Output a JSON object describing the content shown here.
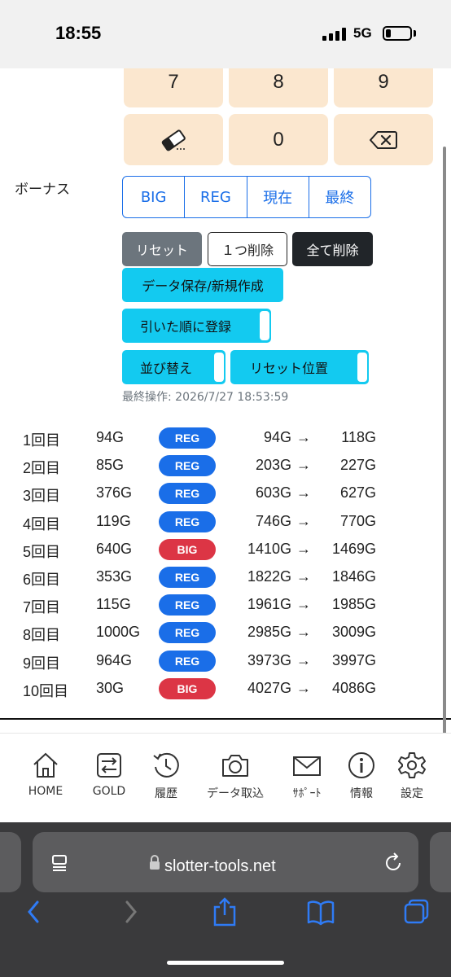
{
  "status": {
    "time": "18:55",
    "network": "5G",
    "battery_level": 0.2
  },
  "keypad": {
    "keys": [
      "7",
      "8",
      "9",
      "0"
    ],
    "eraser_icon": "eraser-icon",
    "backspace_icon": "backspace-icon"
  },
  "bonus": {
    "label": "ボーナス",
    "options": [
      "BIG",
      "REG",
      "現在",
      "最終"
    ]
  },
  "actions": {
    "reset": "リセット",
    "delete_one": "１つ削除",
    "delete_all": "全て削除",
    "save_new": "データ保存/新規作成",
    "register_order": "引いた順に登録",
    "sort": "並び替え",
    "reset_position": "リセット位置"
  },
  "last_operation": "最終操作: 2026/7/27 18:53:59",
  "colors": {
    "reg": "#1a6ee8",
    "big": "#dc3545",
    "cyan": "#13caf0",
    "keypad": "#fbe7cf"
  },
  "history": [
    {
      "n": "1回目",
      "g": "94G",
      "type": "REG",
      "from": "94G",
      "to": "118G"
    },
    {
      "n": "2回目",
      "g": "85G",
      "type": "REG",
      "from": "203G",
      "to": "227G"
    },
    {
      "n": "3回目",
      "g": "376G",
      "type": "REG",
      "from": "603G",
      "to": "627G"
    },
    {
      "n": "4回目",
      "g": "119G",
      "type": "REG",
      "from": "746G",
      "to": "770G"
    },
    {
      "n": "5回目",
      "g": "640G",
      "type": "BIG",
      "from": "1410G",
      "to": "1469G"
    },
    {
      "n": "6回目",
      "g": "353G",
      "type": "REG",
      "from": "1822G",
      "to": "1846G"
    },
    {
      "n": "7回目",
      "g": "115G",
      "type": "REG",
      "from": "1961G",
      "to": "1985G"
    },
    {
      "n": "8回目",
      "g": "1000G",
      "type": "REG",
      "from": "2985G",
      "to": "3009G"
    },
    {
      "n": "9回目",
      "g": "964G",
      "type": "REG",
      "from": "3973G",
      "to": "3997G"
    },
    {
      "n": "10回目",
      "g": "30G",
      "type": "BIG",
      "from": "4027G",
      "to": "4086G"
    }
  ],
  "arrow": "→",
  "tabs": [
    {
      "label": "HOME",
      "icon": "home-icon"
    },
    {
      "label": "GOLD",
      "icon": "exchange-icon"
    },
    {
      "label": "履歴",
      "icon": "history-icon"
    },
    {
      "label": "データ取込",
      "icon": "camera-icon"
    },
    {
      "label": "ｻﾎﾟｰﾄ",
      "icon": "mail-icon"
    },
    {
      "label": "情報",
      "icon": "info-icon"
    },
    {
      "label": "設定",
      "icon": "gear-icon"
    }
  ],
  "browser": {
    "url": "slotter-tools.net"
  }
}
